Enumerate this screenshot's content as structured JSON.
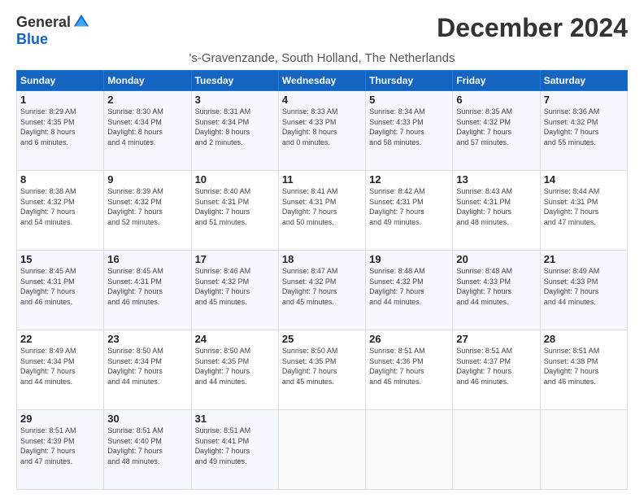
{
  "logo": {
    "general": "General",
    "blue": "Blue"
  },
  "title": "December 2024",
  "subtitle": "'s-Gravenzande, South Holland, The Netherlands",
  "days_of_week": [
    "Sunday",
    "Monday",
    "Tuesday",
    "Wednesday",
    "Thursday",
    "Friday",
    "Saturday"
  ],
  "weeks": [
    [
      {
        "day": "1",
        "info": "Sunrise: 8:29 AM\nSunset: 4:35 PM\nDaylight: 8 hours\nand 6 minutes."
      },
      {
        "day": "2",
        "info": "Sunrise: 8:30 AM\nSunset: 4:34 PM\nDaylight: 8 hours\nand 4 minutes."
      },
      {
        "day": "3",
        "info": "Sunrise: 8:31 AM\nSunset: 4:34 PM\nDaylight: 8 hours\nand 2 minutes."
      },
      {
        "day": "4",
        "info": "Sunrise: 8:33 AM\nSunset: 4:33 PM\nDaylight: 8 hours\nand 0 minutes."
      },
      {
        "day": "5",
        "info": "Sunrise: 8:34 AM\nSunset: 4:33 PM\nDaylight: 7 hours\nand 58 minutes."
      },
      {
        "day": "6",
        "info": "Sunrise: 8:35 AM\nSunset: 4:32 PM\nDaylight: 7 hours\nand 57 minutes."
      },
      {
        "day": "7",
        "info": "Sunrise: 8:36 AM\nSunset: 4:32 PM\nDaylight: 7 hours\nand 55 minutes."
      }
    ],
    [
      {
        "day": "8",
        "info": "Sunrise: 8:38 AM\nSunset: 4:32 PM\nDaylight: 7 hours\nand 54 minutes."
      },
      {
        "day": "9",
        "info": "Sunrise: 8:39 AM\nSunset: 4:32 PM\nDaylight: 7 hours\nand 52 minutes."
      },
      {
        "day": "10",
        "info": "Sunrise: 8:40 AM\nSunset: 4:31 PM\nDaylight: 7 hours\nand 51 minutes."
      },
      {
        "day": "11",
        "info": "Sunrise: 8:41 AM\nSunset: 4:31 PM\nDaylight: 7 hours\nand 50 minutes."
      },
      {
        "day": "12",
        "info": "Sunrise: 8:42 AM\nSunset: 4:31 PM\nDaylight: 7 hours\nand 49 minutes."
      },
      {
        "day": "13",
        "info": "Sunrise: 8:43 AM\nSunset: 4:31 PM\nDaylight: 7 hours\nand 48 minutes."
      },
      {
        "day": "14",
        "info": "Sunrise: 8:44 AM\nSunset: 4:31 PM\nDaylight: 7 hours\nand 47 minutes."
      }
    ],
    [
      {
        "day": "15",
        "info": "Sunrise: 8:45 AM\nSunset: 4:31 PM\nDaylight: 7 hours\nand 46 minutes."
      },
      {
        "day": "16",
        "info": "Sunrise: 8:45 AM\nSunset: 4:31 PM\nDaylight: 7 hours\nand 46 minutes."
      },
      {
        "day": "17",
        "info": "Sunrise: 8:46 AM\nSunset: 4:32 PM\nDaylight: 7 hours\nand 45 minutes."
      },
      {
        "day": "18",
        "info": "Sunrise: 8:47 AM\nSunset: 4:32 PM\nDaylight: 7 hours\nand 45 minutes."
      },
      {
        "day": "19",
        "info": "Sunrise: 8:48 AM\nSunset: 4:32 PM\nDaylight: 7 hours\nand 44 minutes."
      },
      {
        "day": "20",
        "info": "Sunrise: 8:48 AM\nSunset: 4:33 PM\nDaylight: 7 hours\nand 44 minutes."
      },
      {
        "day": "21",
        "info": "Sunrise: 8:49 AM\nSunset: 4:33 PM\nDaylight: 7 hours\nand 44 minutes."
      }
    ],
    [
      {
        "day": "22",
        "info": "Sunrise: 8:49 AM\nSunset: 4:34 PM\nDaylight: 7 hours\nand 44 minutes."
      },
      {
        "day": "23",
        "info": "Sunrise: 8:50 AM\nSunset: 4:34 PM\nDaylight: 7 hours\nand 44 minutes."
      },
      {
        "day": "24",
        "info": "Sunrise: 8:50 AM\nSunset: 4:35 PM\nDaylight: 7 hours\nand 44 minutes."
      },
      {
        "day": "25",
        "info": "Sunrise: 8:50 AM\nSunset: 4:35 PM\nDaylight: 7 hours\nand 45 minutes."
      },
      {
        "day": "26",
        "info": "Sunrise: 8:51 AM\nSunset: 4:36 PM\nDaylight: 7 hours\nand 45 minutes."
      },
      {
        "day": "27",
        "info": "Sunrise: 8:51 AM\nSunset: 4:37 PM\nDaylight: 7 hours\nand 46 minutes."
      },
      {
        "day": "28",
        "info": "Sunrise: 8:51 AM\nSunset: 4:38 PM\nDaylight: 7 hours\nand 46 minutes."
      }
    ],
    [
      {
        "day": "29",
        "info": "Sunrise: 8:51 AM\nSunset: 4:39 PM\nDaylight: 7 hours\nand 47 minutes."
      },
      {
        "day": "30",
        "info": "Sunrise: 8:51 AM\nSunset: 4:40 PM\nDaylight: 7 hours\nand 48 minutes."
      },
      {
        "day": "31",
        "info": "Sunrise: 8:51 AM\nSunset: 4:41 PM\nDaylight: 7 hours\nand 49 minutes."
      },
      {
        "day": "",
        "info": ""
      },
      {
        "day": "",
        "info": ""
      },
      {
        "day": "",
        "info": ""
      },
      {
        "day": "",
        "info": ""
      }
    ]
  ]
}
